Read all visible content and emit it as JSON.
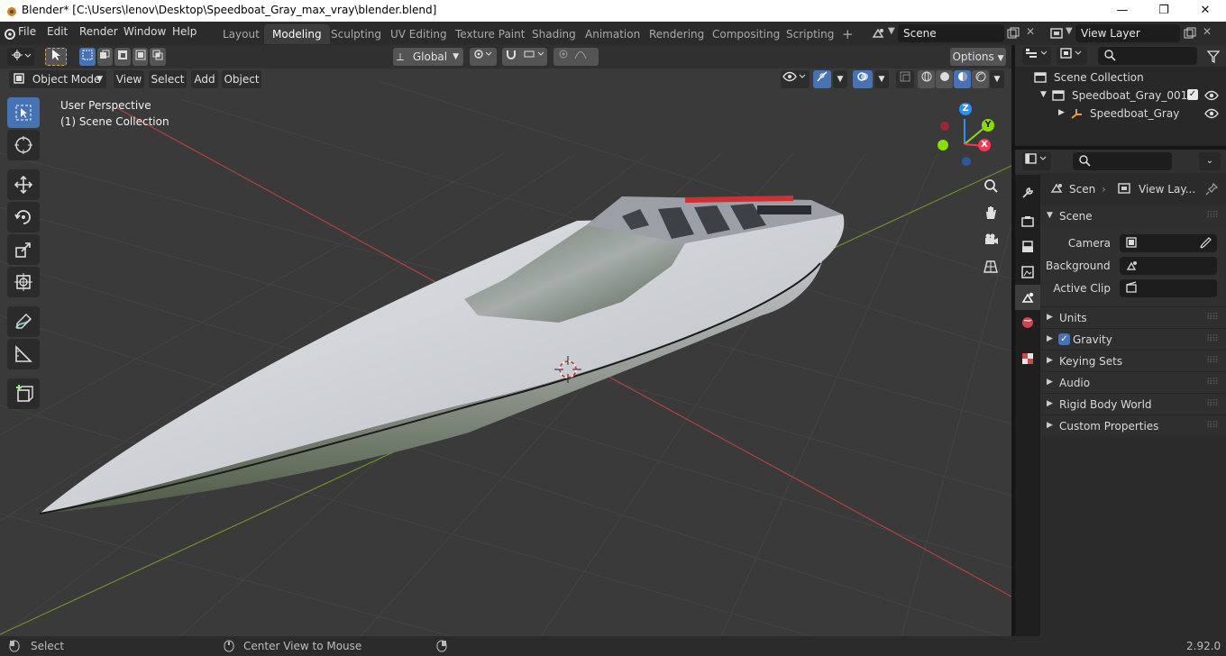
{
  "window": {
    "title": "Blender* [C:\\Users\\lenov\\Desktop\\Speedboat_Gray_max_vray\\blender.blend]",
    "minimize": "—",
    "maximize": "❐",
    "close": "✕"
  },
  "menu": [
    "File",
    "Edit",
    "Render",
    "Window",
    "Help"
  ],
  "workspaces": [
    "Layout",
    "Modeling",
    "Sculpting",
    "UV Editing",
    "Texture Paint",
    "Shading",
    "Animation",
    "Rendering",
    "Compositing",
    "Scripting"
  ],
  "active_workspace": "Modeling",
  "add_workspace": "+",
  "scene_selector": {
    "value": "Scene"
  },
  "view_layer_selector": {
    "value": "View Layer"
  },
  "tool_header": {
    "transform_orientation": "Global",
    "options_label": "Options"
  },
  "viewport_header": {
    "mode": "Object Mode",
    "menus": [
      "View",
      "Select",
      "Add",
      "Object"
    ]
  },
  "viewport": {
    "perspective_label": "User Perspective",
    "collection_label": "(1) Scene Collection",
    "gizmo_axes": {
      "x": "X",
      "y": "Y",
      "z": "Z"
    }
  },
  "outliner": {
    "root": "Scene Collection",
    "items": [
      {
        "label": "Speedboat_Gray_001",
        "level": 1
      },
      {
        "label": "Speedboat_Gray",
        "level": 2
      }
    ]
  },
  "properties": {
    "breadcrumb": {
      "scene": "Scen",
      "view_layer": "View Lay..."
    },
    "scene_panel_title": "Scene",
    "fields": [
      {
        "label": "Camera",
        "value": ""
      },
      {
        "label": "Background ...",
        "value": ""
      },
      {
        "label": "Active Clip",
        "value": ""
      }
    ],
    "subpanels": [
      "Units",
      "Gravity",
      "Keying Sets",
      "Audio",
      "Rigid Body World",
      "Custom Properties"
    ],
    "gravity_checked": true
  },
  "status": {
    "select": "Select",
    "center_view": "Center View to Mouse",
    "version": "2.92.0"
  },
  "colors": {
    "accent": "#4772b3",
    "axis_x": "#ff3352",
    "axis_y": "#8bdc00",
    "axis_z": "#2890ff"
  }
}
